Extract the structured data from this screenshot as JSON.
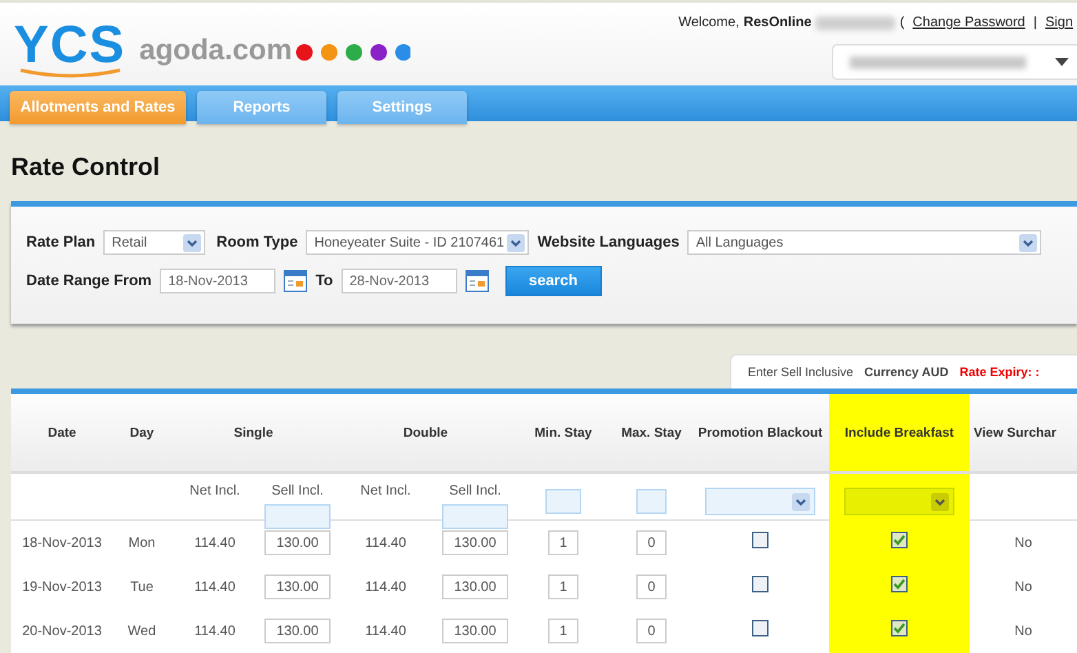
{
  "header": {
    "logo": "YCS",
    "site": "agoda.com",
    "welcome": "Welcome,",
    "user": "ResOnline",
    "open_paren": "(",
    "links": [
      {
        "label": "Change Password"
      },
      {
        "label": "Sign"
      }
    ],
    "separator": "|"
  },
  "nav_tabs": [
    {
      "label": "Allotments and Rates",
      "selected": true
    },
    {
      "label": "Reports",
      "selected": false
    },
    {
      "label": "Settings",
      "selected": false
    }
  ],
  "page_title": "Rate Control",
  "filters": {
    "rate_plan": {
      "label": "Rate Plan",
      "value": "Retail"
    },
    "room_type": {
      "label": "Room Type",
      "value": "Honeyeater Suite - ID 2107461"
    },
    "website_languages": {
      "label": "Website Languages",
      "value": "All Languages"
    },
    "date_from": {
      "label": "Date Range From",
      "value": "18-Nov-2013"
    },
    "date_to": {
      "label": "To",
      "value": "28-Nov-2013"
    },
    "search_button": "search"
  },
  "info_tab": {
    "mode": "Enter Sell Inclusive",
    "currency": "Currency AUD",
    "rate_expiry": "Rate Expiry: :"
  },
  "table": {
    "columns": [
      {
        "label": "Date",
        "highlighted": false
      },
      {
        "label": "Day",
        "highlighted": false
      },
      {
        "label": "Single",
        "highlighted": false,
        "sub": [
          "Net Incl.",
          "Sell Incl."
        ]
      },
      {
        "label": "Double",
        "highlighted": false,
        "sub": [
          "Net Incl.",
          "Sell Incl."
        ]
      },
      {
        "label": "Min. Stay",
        "highlighted": false
      },
      {
        "label": "Max. Stay",
        "highlighted": false
      },
      {
        "label": "Promotion Blackout",
        "highlighted": false
      },
      {
        "label": "Include Breakfast",
        "highlighted": true
      },
      {
        "label": "View Surchar",
        "highlighted": false
      }
    ],
    "rows": [
      {
        "date": "18-Nov-2013",
        "day": "Mon",
        "single_net": "114.40",
        "single_sell": "130.00",
        "double_net": "114.40",
        "double_sell": "130.00",
        "min_stay": "1",
        "max_stay": "0",
        "promotion_blackout": false,
        "include_breakfast": true,
        "surcharge": "No"
      },
      {
        "date": "19-Nov-2013",
        "day": "Tue",
        "single_net": "114.40",
        "single_sell": "130.00",
        "double_net": "114.40",
        "double_sell": "130.00",
        "min_stay": "1",
        "max_stay": "0",
        "promotion_blackout": false,
        "include_breakfast": true,
        "surcharge": "No"
      },
      {
        "date": "20-Nov-2013",
        "day": "Wed",
        "single_net": "114.40",
        "single_sell": "130.00",
        "double_net": "114.40",
        "double_sell": "130.00",
        "min_stay": "1",
        "max_stay": "0",
        "promotion_blackout": false,
        "include_breakfast": true,
        "surcharge": "No"
      }
    ]
  }
}
